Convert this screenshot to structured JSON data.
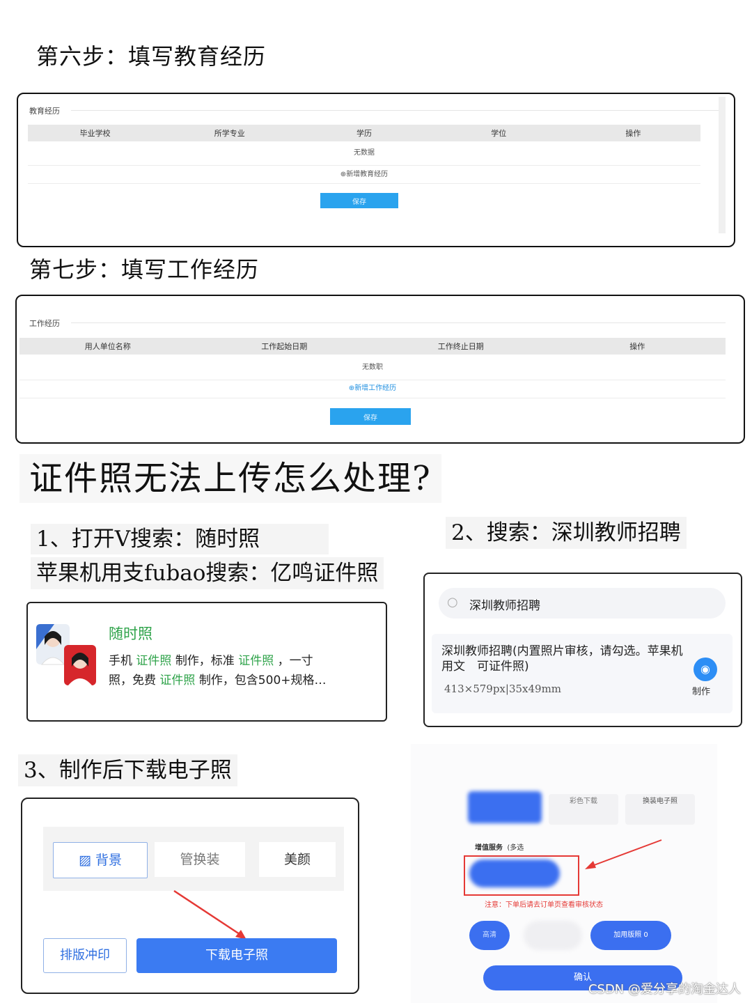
{
  "step6": {
    "title": "第六步：填写教育经历",
    "legend": "教育经历",
    "columns": [
      "毕业学校",
      "所学专业",
      "学历",
      "学位",
      "操作"
    ],
    "empty_text": "无数据",
    "add_link": "新增教育经历",
    "save_label": "保存"
  },
  "step7": {
    "title": "第七步：填写工作经历",
    "legend": "工作经历",
    "columns": [
      "用人单位名称",
      "工作起始日期",
      "工作终止日期",
      "操作"
    ],
    "empty_text": "无数职",
    "add_link": "新增工作经历",
    "save_label": "保存"
  },
  "question": "证件照无法上传怎么处理?",
  "tip1": {
    "line1": "1、打开V搜索：随时照",
    "line2": "苹果机用支fubao搜索：亿鸣证件照"
  },
  "app_card": {
    "name": "随时照",
    "desc_l1_a": "手机",
    "desc_l1_b": "证件照",
    "desc_l1_c": "制作，标准",
    "desc_l1_d": "证件照",
    "desc_l1_e": "，一寸",
    "desc_l2_a": "照，免费",
    "desc_l2_b": "证件照",
    "desc_l2_c": "制作，包含500+规格…"
  },
  "tip2": {
    "title": "2、搜索：深圳教师招聘",
    "search_value": "深圳教师招聘",
    "result_title": "深圳教师招聘(内置照片审核，请勾选。苹果机用文　可证件照)",
    "result_size": "413×579px|35x49mm",
    "make_label": "制作"
  },
  "tip3": {
    "title": "3、制作后下载电子照",
    "tabs": [
      "背景",
      "管换装",
      "美颜"
    ],
    "print_label": "排版冲印",
    "download_label": "下载电子照"
  },
  "right_panel": {
    "tab_color_download": "彩色下载",
    "tab_change_photo": "换装电子照",
    "value_added": "增值服务",
    "multi": "(多选",
    "notice": "注意：下单后请去订单页查看审核状态",
    "hd_label": "高清",
    "add_print": "加用版照 0",
    "confirm": "确认"
  },
  "watermark": "CSDN @爱分享的淘金达人",
  "colors": {
    "blue": "#2aa3ee",
    "button_blue": "#3b7bf2",
    "green": "#2fa34a",
    "red": "#e53935"
  }
}
